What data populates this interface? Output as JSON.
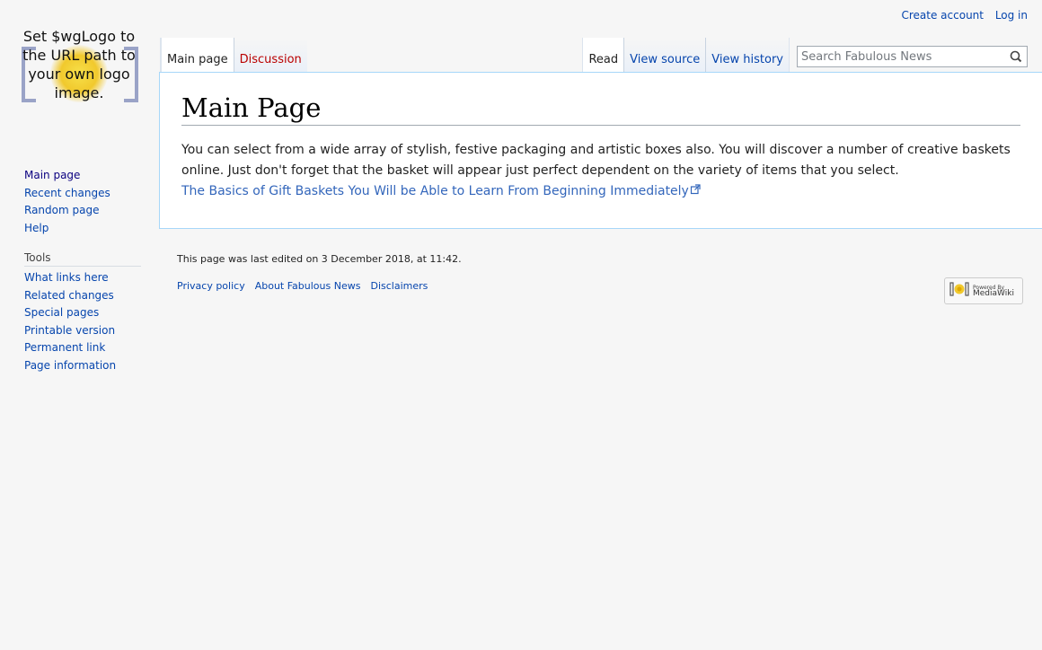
{
  "personal": {
    "create_account": "Create account",
    "log_in": "Log in"
  },
  "logo": {
    "text": "Set $wgLogo to the URL path to your own logo image."
  },
  "tabs": {
    "left": [
      {
        "label": "Main page",
        "selected": true
      },
      {
        "label": "Discussion",
        "new": true
      }
    ],
    "right": [
      {
        "label": "Read",
        "selected": true
      },
      {
        "label": "View source"
      },
      {
        "label": "View history"
      }
    ]
  },
  "search": {
    "placeholder": "Search Fabulous News"
  },
  "page": {
    "title": "Main Page",
    "body": "You can select from a wide array of stylish, festive packaging and artistic boxes also. You will discover a number of creative baskets online. Just don't forget that the basket will appear just perfect dependent on the variety of items that you select.",
    "link": "The Basics of Gift Baskets You Will be Able to Learn From Beginning Immediately"
  },
  "sidebar": {
    "navigation": [
      "Main page",
      "Recent changes",
      "Random page",
      "Help"
    ],
    "tools_label": "Tools",
    "tools": [
      "What links here",
      "Related changes",
      "Special pages",
      "Printable version",
      "Permanent link",
      "Page information"
    ]
  },
  "footer": {
    "last_edited": "This page was last edited on 3 December 2018, at 11:42.",
    "links": [
      "Privacy policy",
      "About Fabulous News",
      "Disclaimers"
    ],
    "powered_small": "Powered By",
    "powered_big": "MediaWiki"
  },
  "colors": {
    "link": "#0645ad",
    "new_link": "#ba0000",
    "border": "#a7d7f9"
  }
}
